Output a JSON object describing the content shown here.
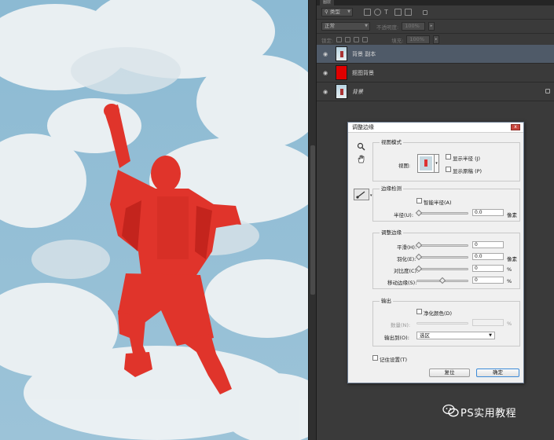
{
  "layers_panel": {
    "tab": "图层",
    "filter_kind": "类型",
    "blend_mode": "正常",
    "opacity_label": "不透明度:",
    "opacity_value": "100%",
    "lock_label": "锁定:",
    "fill_label": "填充:",
    "fill_value": "100%",
    "layers": [
      {
        "name": "背景 副本",
        "selected": true,
        "thumb": "photo"
      },
      {
        "name": "抠图背景",
        "selected": false,
        "thumb": "red"
      },
      {
        "name": "背景",
        "selected": false,
        "thumb": "photo",
        "locked": true
      }
    ]
  },
  "dialog": {
    "title": "调整边缘",
    "close_glyph": "x",
    "view_mode": {
      "label": "视图模式",
      "view_label": "视图:",
      "show_radius": "显示半径 (J)",
      "show_original": "显示原稿 (P)"
    },
    "edge_detection": {
      "label": "边缘检测",
      "smart_radius": "智能半径(A)",
      "radius_label": "半径(U):",
      "radius_value": "0.0",
      "radius_unit": "像素",
      "radius_fraction": 0.0
    },
    "adjust_edge": {
      "label": "调整边缘",
      "rows": [
        {
          "label": "平滑(H):",
          "value": "0",
          "unit": "",
          "fraction": 0.0
        },
        {
          "label": "羽化(E):",
          "value": "0.0",
          "unit": "像素",
          "fraction": 0.0
        },
        {
          "label": "对比度(C):",
          "value": "0",
          "unit": "%",
          "fraction": 0.0
        },
        {
          "label": "移动边缘(S):",
          "value": "0",
          "unit": "%",
          "fraction": 0.5
        }
      ]
    },
    "output": {
      "label": "输出",
      "decontaminate": "净化颜色(D)",
      "amount_label": "数量(N):",
      "amount_unit": "%",
      "output_to_label": "输出到(O):",
      "output_to_value": "选区"
    },
    "remember": "记住设置(T)",
    "reset_button": "复位",
    "ok_button": "确定"
  },
  "watermark": "PS实用教程",
  "colors": {
    "panel_bg": "#3a3a3a",
    "selected_layer": "#4f5a68",
    "overlay_red": "#e0342b",
    "sky": "#7fb2cf"
  }
}
